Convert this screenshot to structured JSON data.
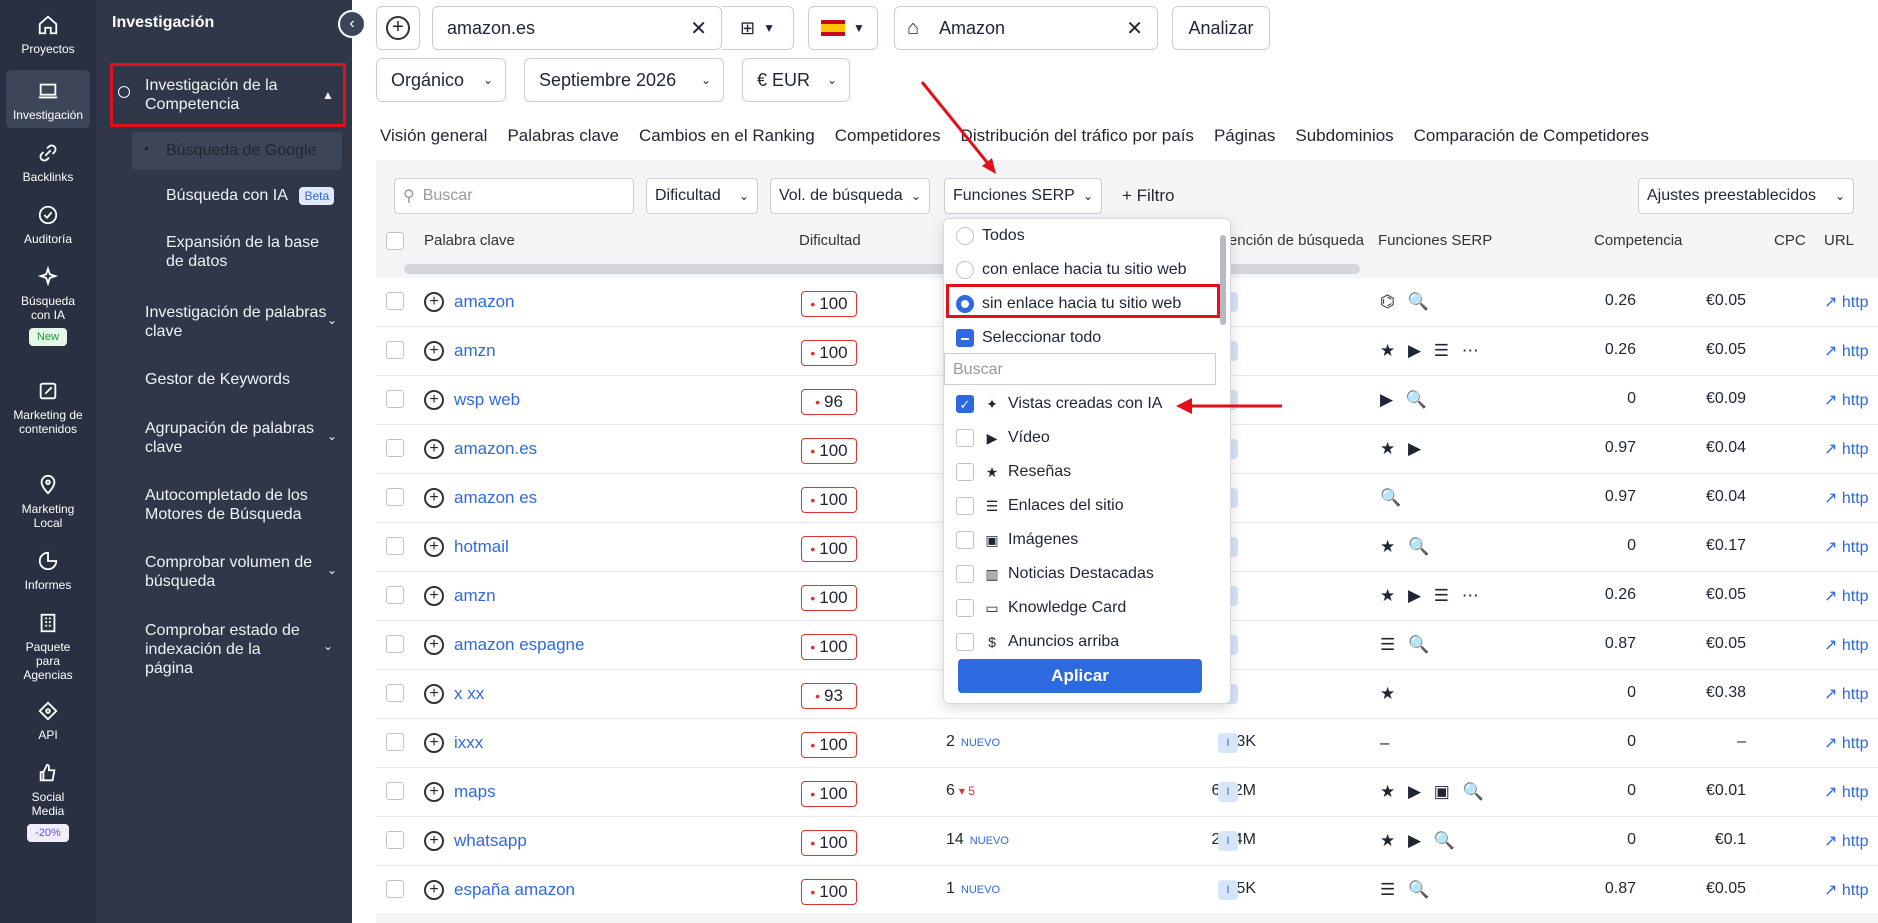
{
  "rail": {
    "items": [
      {
        "label": "Proyectos",
        "icon": "home-icon"
      },
      {
        "label": "Investigación",
        "icon": "laptop-icon"
      },
      {
        "label": "Backlinks",
        "icon": "link-icon"
      },
      {
        "label": "Auditoría",
        "icon": "check-circle-icon"
      },
      {
        "label": "Búsqueda con IA",
        "icon": "sparkle-icon",
        "badge": "New"
      },
      {
        "label": "Marketing de contenidos",
        "icon": "edit-icon"
      },
      {
        "label": "Marketing Local",
        "icon": "pin-icon"
      },
      {
        "label": "Informes",
        "icon": "pie-icon"
      },
      {
        "label": "Paquete para Agencias",
        "icon": "building-icon"
      },
      {
        "label": "API",
        "icon": "api-icon"
      },
      {
        "label": "Social Media",
        "icon": "thumbs-up-icon",
        "badge": "-20%"
      }
    ]
  },
  "sidebar": {
    "title": "Investigación",
    "items": [
      {
        "label": "Investigación de la Competencia"
      },
      {
        "label": "Búsqueda de Google"
      },
      {
        "label": "Búsqueda con IA",
        "badge": "Beta"
      },
      {
        "label": "Expansión de la base de datos"
      },
      {
        "label": "Investigación de palabras clave"
      },
      {
        "label": "Gestor de Keywords"
      },
      {
        "label": "Agrupación de palabras clave"
      },
      {
        "label": "Autocompletado de los Motores de Búsqueda"
      },
      {
        "label": "Comprobar volumen de búsqueda"
      },
      {
        "label": "Comprobar estado de indexación de la página"
      }
    ]
  },
  "toolbar": {
    "domain": "amazon.es",
    "brand": "Amazon",
    "analyze": "Analizar",
    "type": "Orgánico",
    "date": "Septiembre 2026",
    "currency": "€ EUR"
  },
  "tabs": [
    "Visión general",
    "Palabras clave",
    "Cambios en el Ranking",
    "Competidores",
    "Distribución del tráfico por país",
    "Páginas",
    "Subdominios",
    "Comparación de Competidores"
  ],
  "filters": {
    "search_placeholder": "Buscar",
    "difficulty": "Dificultad",
    "volume": "Vol. de búsqueda",
    "serp": "Funciones SERP",
    "filter": "Filtro",
    "presets": "Ajustes preestablecidos"
  },
  "columns": {
    "keyword": "Palabra clave",
    "difficulty": "Dificultad",
    "intent": "Intención de búsqueda",
    "serp": "Funciones SERP",
    "competition": "Competencia",
    "cpc": "CPC",
    "url": "URL"
  },
  "rows": [
    {
      "kw": "amazon",
      "diff": "100",
      "serp": "⌬ 🔍",
      "comp": "0.26",
      "cpc": "€0.05",
      "url": "http"
    },
    {
      "kw": "amzn",
      "diff": "100",
      "serp": "★ ▶ ☰ ⋯",
      "comp": "0.26",
      "cpc": "€0.05",
      "url": "http"
    },
    {
      "kw": "wsp web",
      "diff": "96",
      "serp": "▶ 🔍",
      "comp": "0",
      "cpc": "€0.09",
      "url": "http"
    },
    {
      "kw": "amazon.es",
      "diff": "100",
      "serp": "★ ▶",
      "comp": "0.97",
      "cpc": "€0.04",
      "url": "http"
    },
    {
      "kw": "amazon es",
      "diff": "100",
      "serp": "🔍",
      "comp": "0.97",
      "cpc": "€0.04",
      "url": "http"
    },
    {
      "kw": "hotmail",
      "diff": "100",
      "serp": "★ 🔍",
      "comp": "0",
      "cpc": "€0.17",
      "url": "http"
    },
    {
      "kw": "amzn",
      "diff": "100",
      "serp": "★ ▶ ☰ ⋯",
      "comp": "0.26",
      "cpc": "€0.05",
      "url": "http"
    },
    {
      "kw": "amazon espagne",
      "diff": "100",
      "serp": "☰ 🔍",
      "comp": "0.87",
      "cpc": "€0.05",
      "url": "http"
    },
    {
      "kw": "x xx",
      "diff": "93",
      "serp": "★",
      "comp": "0",
      "cpc": "€0.38",
      "url": "http"
    },
    {
      "kw": "ixxx",
      "diff": "100",
      "vol": "2",
      "new": "NUEVO",
      "traf": "673K",
      "serp": "–",
      "comp": "0",
      "cpc": "–",
      "url": "http"
    },
    {
      "kw": "maps",
      "diff": "100",
      "vol": "6",
      "down": "▾ 5",
      "traf": "6.12M",
      "serp": "★ ▶ ▣ 🔍",
      "comp": "0",
      "cpc": "€0.01",
      "url": "http"
    },
    {
      "kw": "whatsapp",
      "diff": "100",
      "vol": "14",
      "new": "NUEVO",
      "traf": "2.74M",
      "serp": "★ ▶ 🔍",
      "comp": "0",
      "cpc": "€0.1",
      "url": "http"
    },
    {
      "kw": "españa amazon",
      "diff": "100",
      "vol": "1",
      "new": "NUEVO",
      "traf": "165K",
      "serp": "☰ 🔍",
      "comp": "0.87",
      "cpc": "€0.05",
      "url": "http"
    }
  ],
  "intent_badge": "I",
  "dropdown": {
    "radios": [
      "Todos",
      "con enlace hacia tu sitio web",
      "sin enlace hacia tu sitio web"
    ],
    "select_all": "Seleccionar todo",
    "search_placeholder": "Buscar",
    "options": [
      "Vistas creadas con IA",
      "Vídeo",
      "Reseñas",
      "Enlaces del sitio",
      "Imágenes",
      "Noticias Destacadas",
      "Knowledge Card",
      "Anuncios arriba"
    ],
    "apply": "Aplicar"
  },
  "colors": {
    "accent": "#2e6adf",
    "highlight": "#e3101a",
    "rail": "#283041",
    "sidebar": "#2f3748"
  }
}
